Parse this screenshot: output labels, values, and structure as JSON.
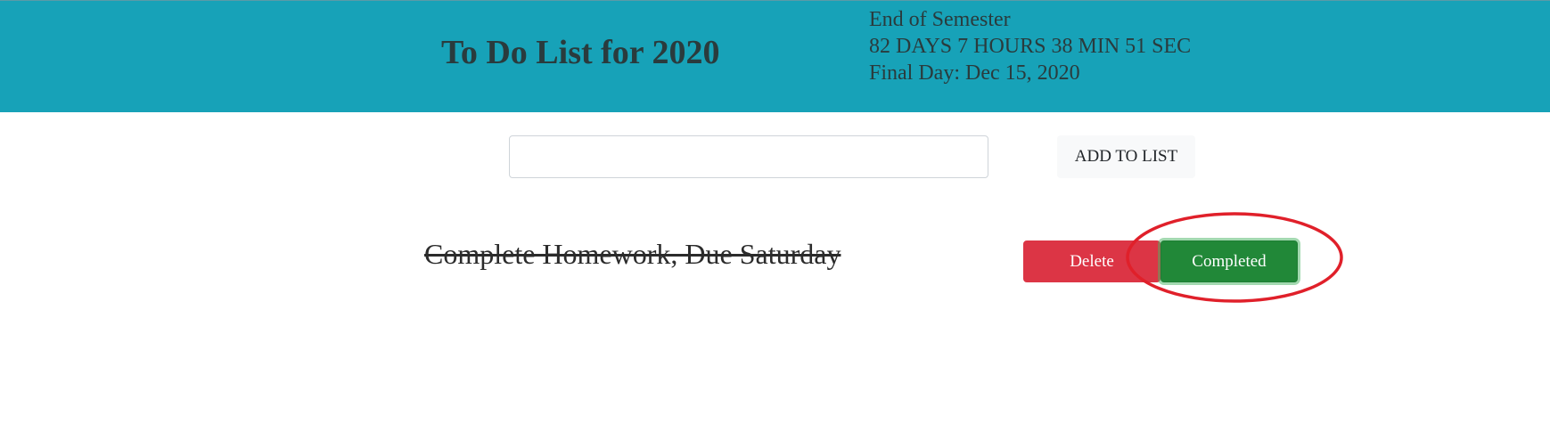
{
  "header": {
    "title": "To Do List for 2020",
    "countdown": {
      "label": "End of Semester",
      "remaining": "82 DAYS 7 HOURS 38 MIN 51 SEC",
      "final_day": "Final Day: Dec 15, 2020"
    },
    "background_color": "#17a2b8"
  },
  "add_form": {
    "input_value": "",
    "input_placeholder": "",
    "add_button_label": "ADD TO LIST"
  },
  "todos": [
    {
      "text": "Complete Homework, Due Saturday",
      "completed": true,
      "delete_label": "Delete",
      "completed_label": "Completed"
    }
  ],
  "colors": {
    "delete": "#dc3545",
    "completed": "#218838",
    "annotation": "#e0202a"
  }
}
